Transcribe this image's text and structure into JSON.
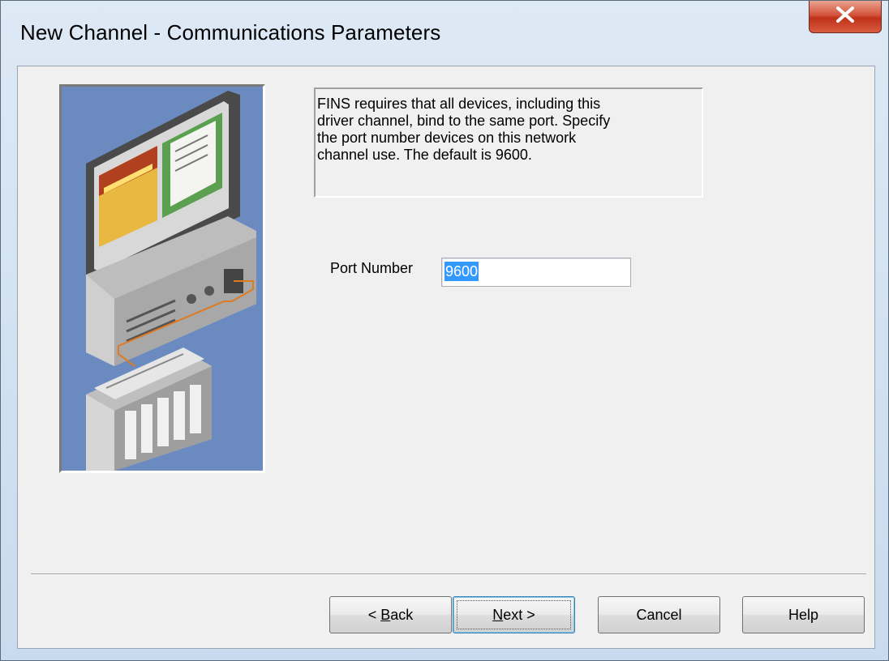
{
  "window": {
    "title": "New Channel - Communications Parameters",
    "close_glyph": "X",
    "close_icon": "close-icon"
  },
  "description": {
    "lines": [
      "FINS requires that all devices, including this",
      "driver channel, bind to the same port.  Specify",
      "the port number devices on this network",
      "channel use.  The default is 9600."
    ]
  },
  "port": {
    "label": "Port Number",
    "value": "9600",
    "selected": true
  },
  "buttons": {
    "back_prefix": "< ",
    "back_mnemonic": "B",
    "back_rest": "ack",
    "next_mnemonic": "N",
    "next_rest": "ext >",
    "cancel": "Cancel",
    "help": "Help"
  },
  "illustration": {
    "icon": "computer-network-plc-illustration"
  },
  "colors": {
    "selection": "#3399ff",
    "dialog_bg": "#f0f0f0",
    "illustration_bg": "#6b8bc0",
    "close_red": "#c0311a"
  }
}
